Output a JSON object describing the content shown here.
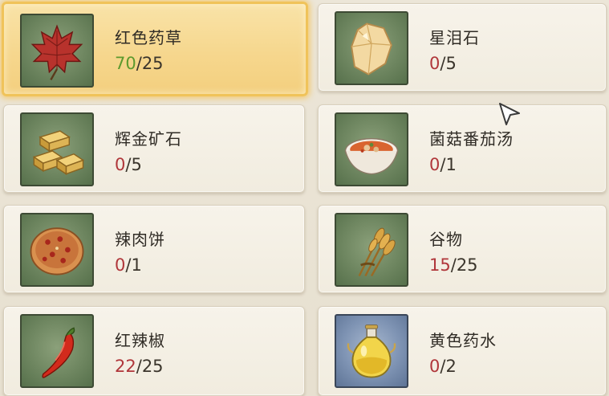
{
  "colors": {
    "enough": "#5d9a2e",
    "insufficient": "#b0363a",
    "selected_border": "#f0c35a"
  },
  "items": [
    {
      "name": "红色药草",
      "have": "70",
      "sep": "/",
      "need": "25",
      "status": "enough",
      "icon": "red-herb-leaf-icon",
      "selected": true
    },
    {
      "name": "星泪石",
      "have": "0",
      "sep": "/",
      "need": "5",
      "status": "insufficient",
      "icon": "star-tear-stone-icon",
      "selected": false
    },
    {
      "name": "辉金矿石",
      "have": "0",
      "sep": "/",
      "need": "5",
      "status": "insufficient",
      "icon": "gold-ore-bars-icon",
      "selected": false
    },
    {
      "name": "菌菇番茄汤",
      "have": "0",
      "sep": "/",
      "need": "1",
      "status": "insufficient",
      "icon": "mushroom-tomato-soup-icon",
      "selected": false
    },
    {
      "name": "辣肉饼",
      "have": "0",
      "sep": "/",
      "need": "1",
      "status": "insufficient",
      "icon": "spicy-meat-pie-icon",
      "selected": false
    },
    {
      "name": "谷物",
      "have": "15",
      "sep": "/",
      "need": "25",
      "status": "insufficient",
      "icon": "grain-wheat-icon",
      "selected": false
    },
    {
      "name": "红辣椒",
      "have": "22",
      "sep": "/",
      "need": "25",
      "status": "insufficient",
      "icon": "red-chili-pepper-icon",
      "selected": false
    },
    {
      "name": "黄色药水",
      "have": "0",
      "sep": "/",
      "need": "2",
      "status": "insufficient",
      "icon": "yellow-potion-flask-icon",
      "selected": false
    }
  ]
}
